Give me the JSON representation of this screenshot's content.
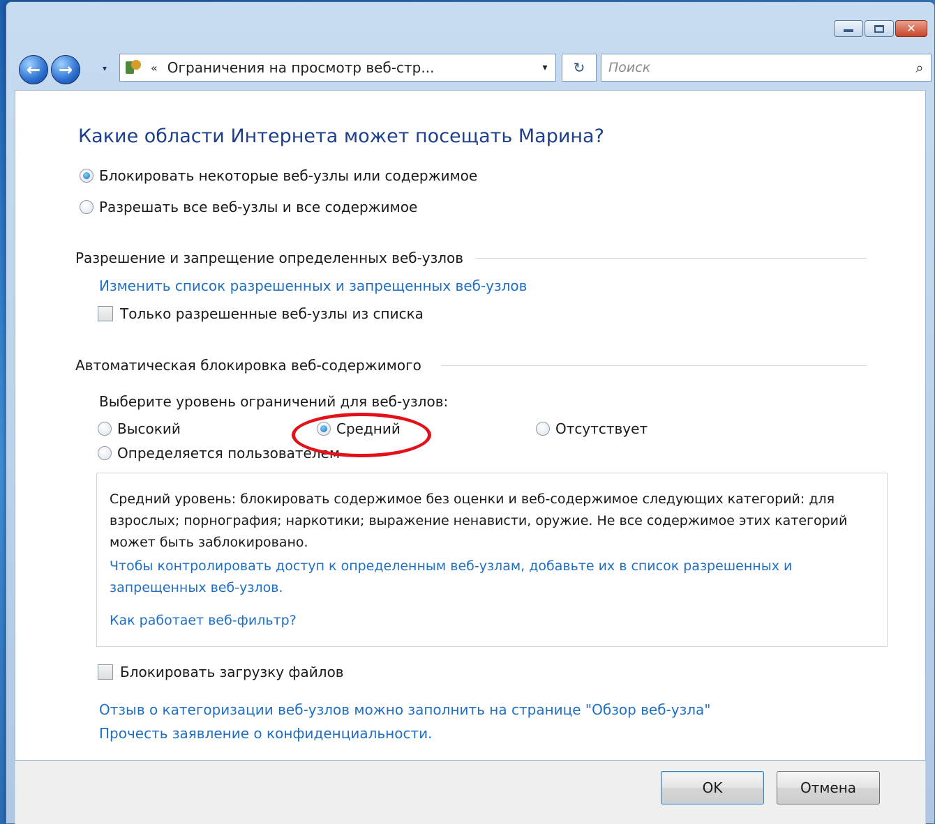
{
  "window": {
    "caption": {
      "minimize_glyph": "minimize-icon",
      "maximize_glyph": "maximize-icon",
      "close_glyph": "✕"
    }
  },
  "navbar": {
    "back_glyph": "←",
    "forward_glyph": "→",
    "history_glyph": "▾",
    "address_chevrons": "«",
    "address_text": "Ограничения на просмотр веб-стр...",
    "address_dropdown_glyph": "▾",
    "refresh_glyph": "↻",
    "search_placeholder": "Поиск",
    "search_glyph": "⌕"
  },
  "main": {
    "heading": "Какие области Интернета может посещать Марина?",
    "access_options": [
      {
        "label": "Блокировать некоторые веб-узлы или содержимое",
        "checked": true
      },
      {
        "label": "Разрешать все веб-узлы и все содержимое",
        "checked": false
      }
    ],
    "allow_block_section": {
      "title": "Разрешение и запрещение определенных веб-узлов",
      "edit_list_link": "Изменить список разрешенных и  запрещенных веб-узлов",
      "only_allowed_checkbox": {
        "label": "Только разрешенные веб-узлы из списка",
        "checked": false
      }
    },
    "auto_block_section": {
      "title": "Автоматическая блокировка веб-содержимого",
      "prompt": "Выберите уровень ограничений для веб-узлов:",
      "levels": [
        {
          "label": "Высокий",
          "checked": false
        },
        {
          "label": "Средний",
          "checked": true
        },
        {
          "label": "Отсутствует",
          "checked": false
        },
        {
          "label": "Определяется пользователем",
          "checked": false
        }
      ],
      "description": "Средний уровень: блокировать содержимое без оценки и веб-содержимое следующих категорий: для взрослых; порнография; наркотики; выражение ненависти, оружие. Не все содержимое этих категорий может быть заблокировано.",
      "control_access_link": "Чтобы контролировать доступ к определенным веб-узлам, добавьте их в список разрешенных и запрещенных веб-узлов.",
      "how_filter_works_link": "Как работает веб-фильтр?"
    },
    "block_downloads_checkbox": {
      "label": "Блокировать загрузку файлов",
      "checked": false
    },
    "feedback_link": "Отзыв о категоризации веб-узлов можно заполнить на странице \"Обзор веб-узла\"",
    "privacy_link": "Прочесть заявление о конфиденциальности."
  },
  "buttons": {
    "ok_label": "OK",
    "cancel_label": "Отмена"
  },
  "colors": {
    "heading": "#1e3f8c",
    "link": "#1f6fc4",
    "highlight": "#e3121a"
  }
}
